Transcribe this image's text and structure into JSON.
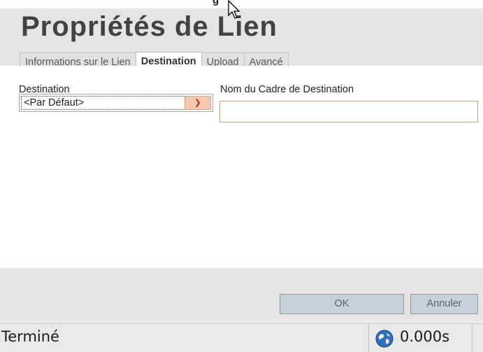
{
  "window": {
    "title_fragment": "g"
  },
  "dialog": {
    "title": "Propriétés de Lien",
    "tabs": [
      {
        "label": "Informations sur le Lien",
        "active": false
      },
      {
        "label": "Destination",
        "active": true
      },
      {
        "label": "Upload",
        "active": false
      },
      {
        "label": "Avancé",
        "active": false
      }
    ],
    "fields": {
      "destination_label": "Destination",
      "destination_value": "<Par Défaut>",
      "frame_name_label": "Nom du Cadre de Destination",
      "frame_name_value": ""
    },
    "buttons": {
      "ok": "OK",
      "cancel": "Annuler"
    }
  },
  "statusbar": {
    "status": "Terminé",
    "time": "0.000s"
  },
  "icons": {
    "select_arrow": "chevron-down-icon",
    "globe": "globe-icon",
    "cursor": "mouse-cursor-icon"
  },
  "colors": {
    "active_tab": "#ffffff",
    "select_arrow_bg": "#f6c9b0",
    "button_bg": "#c6d3da"
  }
}
